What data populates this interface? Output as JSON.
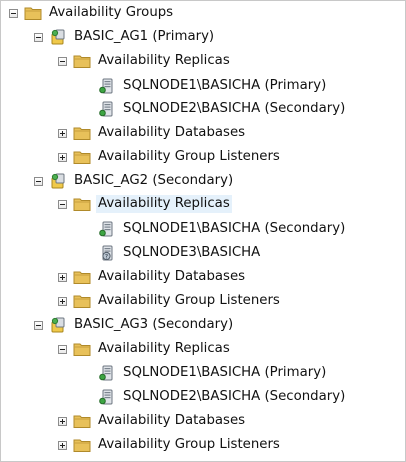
{
  "root": {
    "label": "Availability Groups",
    "icon": "folder-icon"
  },
  "groups": [
    {
      "label": "BASIC_AG1 (Primary)",
      "icon": "availability-group-icon",
      "replicas_label": "Availability Replicas",
      "replicas": [
        {
          "label": "SQLNODE1\\BASICHA (Primary)",
          "icon": "replica-server-icon"
        },
        {
          "label": "SQLNODE2\\BASICHA (Secondary)",
          "icon": "replica-server-icon"
        }
      ],
      "databases_label": "Availability Databases",
      "listeners_label": "Availability Group Listeners"
    },
    {
      "label": "BASIC_AG2 (Secondary)",
      "icon": "availability-group-icon",
      "replicas_label": "Availability Replicas",
      "replicas": [
        {
          "label": "SQLNODE1\\BASICHA (Secondary)",
          "icon": "replica-server-icon"
        },
        {
          "label": "SQLNODE3\\BASICHA",
          "icon": "replica-server-unknown-icon"
        }
      ],
      "databases_label": "Availability Databases",
      "listeners_label": "Availability Group Listeners"
    },
    {
      "label": "BASIC_AG3 (Secondary)",
      "icon": "availability-group-icon",
      "replicas_label": "Availability Replicas",
      "replicas": [
        {
          "label": "SQLNODE1\\BASICHA (Primary)",
          "icon": "replica-server-icon"
        },
        {
          "label": "SQLNODE2\\BASICHA (Secondary)",
          "icon": "replica-server-icon"
        }
      ],
      "databases_label": "Availability Databases",
      "listeners_label": "Availability Group Listeners"
    }
  ],
  "colors": {
    "folder": "#e8c15a",
    "selection": "#e5f1fb"
  }
}
